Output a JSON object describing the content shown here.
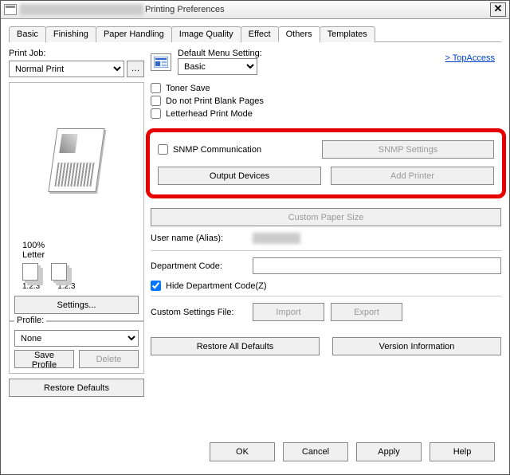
{
  "window": {
    "title": "Printing Preferences"
  },
  "tabs": [
    "Basic",
    "Finishing",
    "Paper Handling",
    "Image Quality",
    "Effect",
    "Others",
    "Templates"
  ],
  "activeTab": "Others",
  "left": {
    "printJobLabel": "Print Job:",
    "printJobValue": "Normal Print",
    "zoom": "100%",
    "paperSize": "Letter",
    "stackLabel": "1.2.3",
    "settingsBtn": "Settings...",
    "profileLegend": "Profile:",
    "profileValue": "None",
    "saveProfileBtn": "Save Profile",
    "deleteBtn": "Delete",
    "restoreDefaultsBtn": "Restore Defaults"
  },
  "right": {
    "defaultMenuLabel": "Default Menu Setting:",
    "defaultMenuValue": "Basic",
    "topAccess": "> TopAccess",
    "tonerSave": "Toner Save",
    "noBlank": "Do not Print Blank Pages",
    "letterhead": "Letterhead Print Mode",
    "snmpComm": "SNMP Communication",
    "snmpSettingsBtn": "SNMP Settings",
    "outputDevicesBtn": "Output Devices",
    "addPrinterBtn": "Add Printer",
    "customPaperSizeBtn": "Custom Paper Size",
    "userNameLabel": "User name (Alias):",
    "deptCodeLabel": "Department Code:",
    "hideDeptCode": "Hide Department Code(Z)",
    "customSettingsLabel": "Custom Settings File:",
    "importBtn": "Import",
    "exportBtn": "Export",
    "restoreAllBtn": "Restore All Defaults",
    "versionInfoBtn": "Version Information"
  },
  "footer": {
    "ok": "OK",
    "cancel": "Cancel",
    "apply": "Apply",
    "help": "Help"
  }
}
